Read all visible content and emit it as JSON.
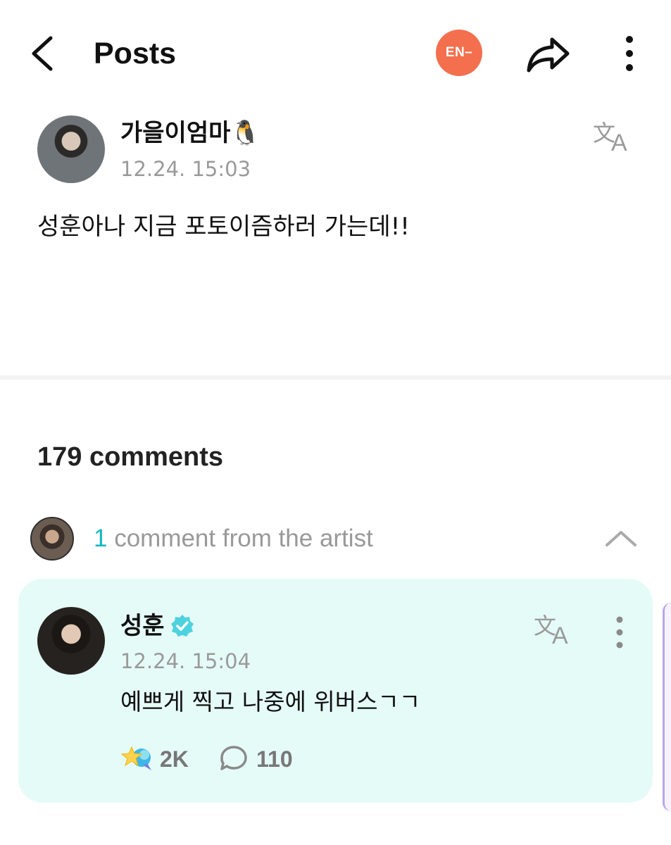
{
  "header": {
    "title": "Posts",
    "community_badge": "EN–",
    "community_color": "#f36f4e",
    "icons": [
      "back-arrow-icon",
      "share-icon",
      "more-vertical-icon"
    ]
  },
  "post": {
    "author": "가을이엄마🐧",
    "timestamp": "12.24. 15:03",
    "body": "성훈아나 지금 포토이즘하러 가는데!!",
    "translate_icon": "translate-icon"
  },
  "comments": {
    "count_label": "179 comments"
  },
  "artist_strip": {
    "count": "1",
    "label": " comment from the artist",
    "accent_color": "#16b7c2",
    "toggle_icon": "chevron-up-icon"
  },
  "artist_comment": {
    "author": "성훈",
    "verified_icon": "verified-badge-icon",
    "timestamp": "12.24. 15:04",
    "body": "예쁘게 찍고 나중에 위버스ㄱㄱ",
    "likes": "2K",
    "replies": "110",
    "card_color": "#e5fbf7"
  }
}
